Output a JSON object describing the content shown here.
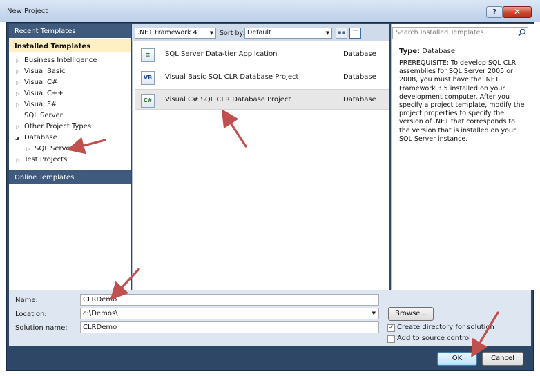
{
  "window": {
    "title": "New Project",
    "help_label": "?",
    "close_label": "✕"
  },
  "left_pane": {
    "recent_label": "Recent Templates",
    "installed_label": "Installed Templates",
    "tree": [
      {
        "label": "Business Intelligence",
        "level": 0,
        "state": "collapsed"
      },
      {
        "label": "Visual Basic",
        "level": 0,
        "state": "collapsed"
      },
      {
        "label": "Visual C#",
        "level": 0,
        "state": "collapsed"
      },
      {
        "label": "Visual C++",
        "level": 0,
        "state": "collapsed"
      },
      {
        "label": "Visual F#",
        "level": 0,
        "state": "collapsed"
      },
      {
        "label": "SQL Server",
        "level": 0,
        "state": "leaf"
      },
      {
        "label": "Other Project Types",
        "level": 0,
        "state": "collapsed"
      },
      {
        "label": "Database",
        "level": 0,
        "state": "expanded"
      },
      {
        "label": "SQL Server",
        "level": 1,
        "state": "collapsed"
      },
      {
        "label": "Test Projects",
        "level": 0,
        "state": "collapsed"
      }
    ],
    "online_label": "Online Templates"
  },
  "toolbar": {
    "framework": ".NET Framework 4",
    "sort_label": "Sort by:",
    "sort_value": "Default"
  },
  "projects": [
    {
      "name": "SQL Server Data-tier Application",
      "category": "Database",
      "icon": "data-tier-app-icon"
    },
    {
      "name": "Visual Basic SQL CLR Database Project",
      "category": "Database",
      "icon": "vb-project-icon"
    },
    {
      "name": "Visual C# SQL CLR Database Project",
      "category": "Database",
      "icon": "csharp-project-icon",
      "selected": true
    }
  ],
  "details": {
    "search_placeholder": "Search Installed Templates",
    "type_label": "Type:",
    "type_value": "Database",
    "description": "PREREQUISITE: To develop SQL CLR assemblies for SQL Server 2005 or 2008, you must have the .NET Framework 3.5 installed on your development computer. After you specify a project template, modify the project properties to specify the version of .NET that corresponds to the version that is installed on your SQL Server instance."
  },
  "form": {
    "name_label": "Name:",
    "name_value": "CLRDemo",
    "location_label": "Location:",
    "location_value": "c:\\Demos\\",
    "solution_label": "Solution name:",
    "solution_value": "CLRDemo",
    "browse_label": "Browse...",
    "create_dir_label": "Create directory for solution",
    "create_dir_checked": true,
    "source_control_label": "Add to source control",
    "source_control_checked": false,
    "ok_label": "OK",
    "cancel_label": "Cancel"
  },
  "colors": {
    "annotation_arrow": "#c0504d",
    "header_blue": "#3f5a7d",
    "selected_highlight": "#fff0c4"
  }
}
